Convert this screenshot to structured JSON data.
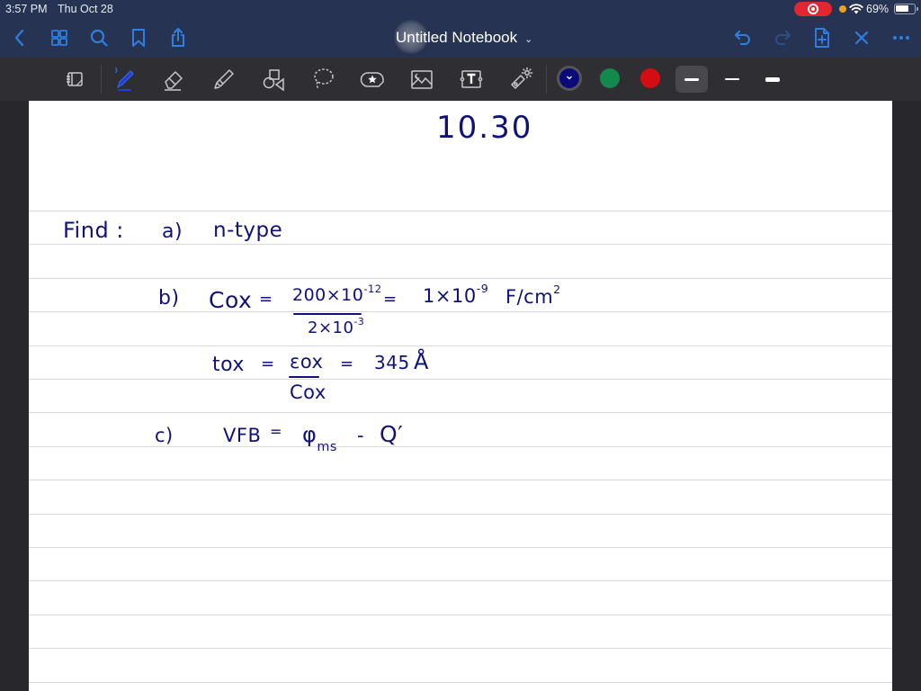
{
  "status_bar": {
    "time": "3:57 PM",
    "date": "Thu Oct 28",
    "battery_percent": "69%",
    "battery_level": 0.69,
    "icons": [
      "screen-recording-icon",
      "mic-indicator-icon",
      "wifi-icon",
      "battery-icon"
    ]
  },
  "nav_bar": {
    "title": "Untitled Notebook",
    "left_buttons": [
      {
        "name": "back",
        "icon": "chevron-left-icon"
      },
      {
        "name": "thumbnails",
        "icon": "grid-icon"
      },
      {
        "name": "search",
        "icon": "search-icon"
      },
      {
        "name": "bookmark",
        "icon": "bookmark-icon"
      },
      {
        "name": "share",
        "icon": "share-icon"
      }
    ],
    "right_buttons": [
      {
        "name": "undo",
        "icon": "undo-icon",
        "enabled": true
      },
      {
        "name": "redo",
        "icon": "redo-icon",
        "enabled": false
      },
      {
        "name": "add-page",
        "icon": "add-page-icon"
      },
      {
        "name": "close",
        "icon": "close-icon"
      },
      {
        "name": "more",
        "icon": "more-icon"
      }
    ]
  },
  "toolbar": {
    "tools": [
      {
        "name": "read-only-mode",
        "icon": "page-view-icon"
      },
      {
        "name": "pen",
        "icon": "pen-icon",
        "selected": true,
        "bluetooth": true
      },
      {
        "name": "eraser",
        "icon": "eraser-icon"
      },
      {
        "name": "highlighter",
        "icon": "highlighter-icon"
      },
      {
        "name": "shapes",
        "icon": "shapes-icon"
      },
      {
        "name": "lasso",
        "icon": "lasso-icon"
      },
      {
        "name": "elements",
        "icon": "sticker-icon"
      },
      {
        "name": "image",
        "icon": "image-icon"
      },
      {
        "name": "text",
        "icon": "text-box-icon"
      },
      {
        "name": "laser-pointer",
        "icon": "laser-pointer-icon"
      }
    ],
    "colors": [
      {
        "name": "navy",
        "hex": "#0a0a7a",
        "selected": true
      },
      {
        "name": "green",
        "hex": "#14894e",
        "selected": false
      },
      {
        "name": "red",
        "hex": "#d40d12",
        "selected": false
      }
    ],
    "stroke_widths": [
      {
        "name": "medium",
        "selected": true
      },
      {
        "name": "thin",
        "selected": false
      },
      {
        "name": "thick",
        "selected": false
      }
    ]
  },
  "notebook": {
    "ink_color": "#10127a",
    "heading": "10.30",
    "find_label": "Find :",
    "part_a": {
      "label": "a)",
      "text": "n-type"
    },
    "part_b": {
      "label": "b)",
      "cox_lhs": "Cox",
      "eq1": "=",
      "num_base": "200×10",
      "num_exp": "-12",
      "den_base": "2×10",
      "den_exp": "-3",
      "eq2": "=",
      "result_base": "1×10",
      "result_exp": "-9",
      "result_unit": "F/cm",
      "result_unit_exp": "2",
      "tox_lhs": "tox",
      "tox_eq1": "=",
      "tox_num": "εox",
      "tox_den": "Cox",
      "tox_eq2": "=",
      "tox_value": "345",
      "tox_unit": "Å"
    },
    "part_c": {
      "label": "c)",
      "lhs": "VFB",
      "eq": "=",
      "phi": "φ",
      "phi_sub": "ms",
      "minus": "-",
      "q_term": "Q′"
    }
  }
}
